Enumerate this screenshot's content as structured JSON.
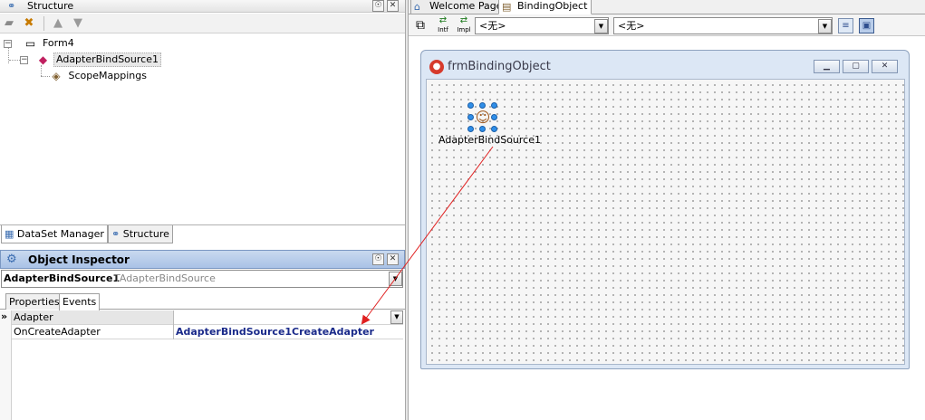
{
  "structure_panel": {
    "title": "Structure",
    "pin_glyph": "☉",
    "close_glyph": "✕",
    "toolbar_icons": [
      "new-item-icon",
      "delete-item-icon",
      "move-up-icon",
      "move-down-icon"
    ],
    "tree": {
      "root": {
        "label": "Form4",
        "expander": "−",
        "children": [
          {
            "label": "AdapterBindSource1",
            "expander": "−",
            "children": [
              {
                "label": "ScopeMappings"
              }
            ]
          }
        ]
      }
    }
  },
  "panel_tabs": [
    {
      "label": "DataSet Manager",
      "active": true
    },
    {
      "label": "Structure",
      "active": false
    }
  ],
  "object_inspector": {
    "title": "Object Inspector",
    "pin_glyph": "☉",
    "close_glyph": "✕",
    "selected_component": "AdapterBindSource1",
    "selected_type": "TAdapterBindSource",
    "tabs": [
      {
        "label": "Properties",
        "active": false
      },
      {
        "label": "Events",
        "active": true
      }
    ],
    "gutter_marker": "»",
    "rows": [
      {
        "name": "Adapter",
        "value": "",
        "has_dropdown": true
      },
      {
        "name": "OnCreateAdapter",
        "value": "AdapterBindSource1CreateAdapter",
        "has_dropdown": false
      }
    ]
  },
  "editor": {
    "tabs": [
      {
        "label": "Welcome Page",
        "active": false,
        "icon": "home-icon"
      },
      {
        "label": "BindingObject",
        "active": true,
        "icon": "unit-file-icon"
      }
    ],
    "toolbar": {
      "intf_label": "Intf",
      "impl_label": "Impl",
      "combo1_value": "<无>",
      "combo2_value": "<无>"
    }
  },
  "form_designer": {
    "window_title": "frmBindingObject",
    "window_buttons": [
      "minimize",
      "maximize",
      "close"
    ],
    "component": {
      "label": "AdapterBindSource1",
      "icon": "adapter-bind-source-icon"
    }
  },
  "colors": {
    "accent": "#2f8ee8",
    "arrow": "#e02020",
    "event_value": "#1a2a8a",
    "inspector_header": "#a9c2e6"
  }
}
